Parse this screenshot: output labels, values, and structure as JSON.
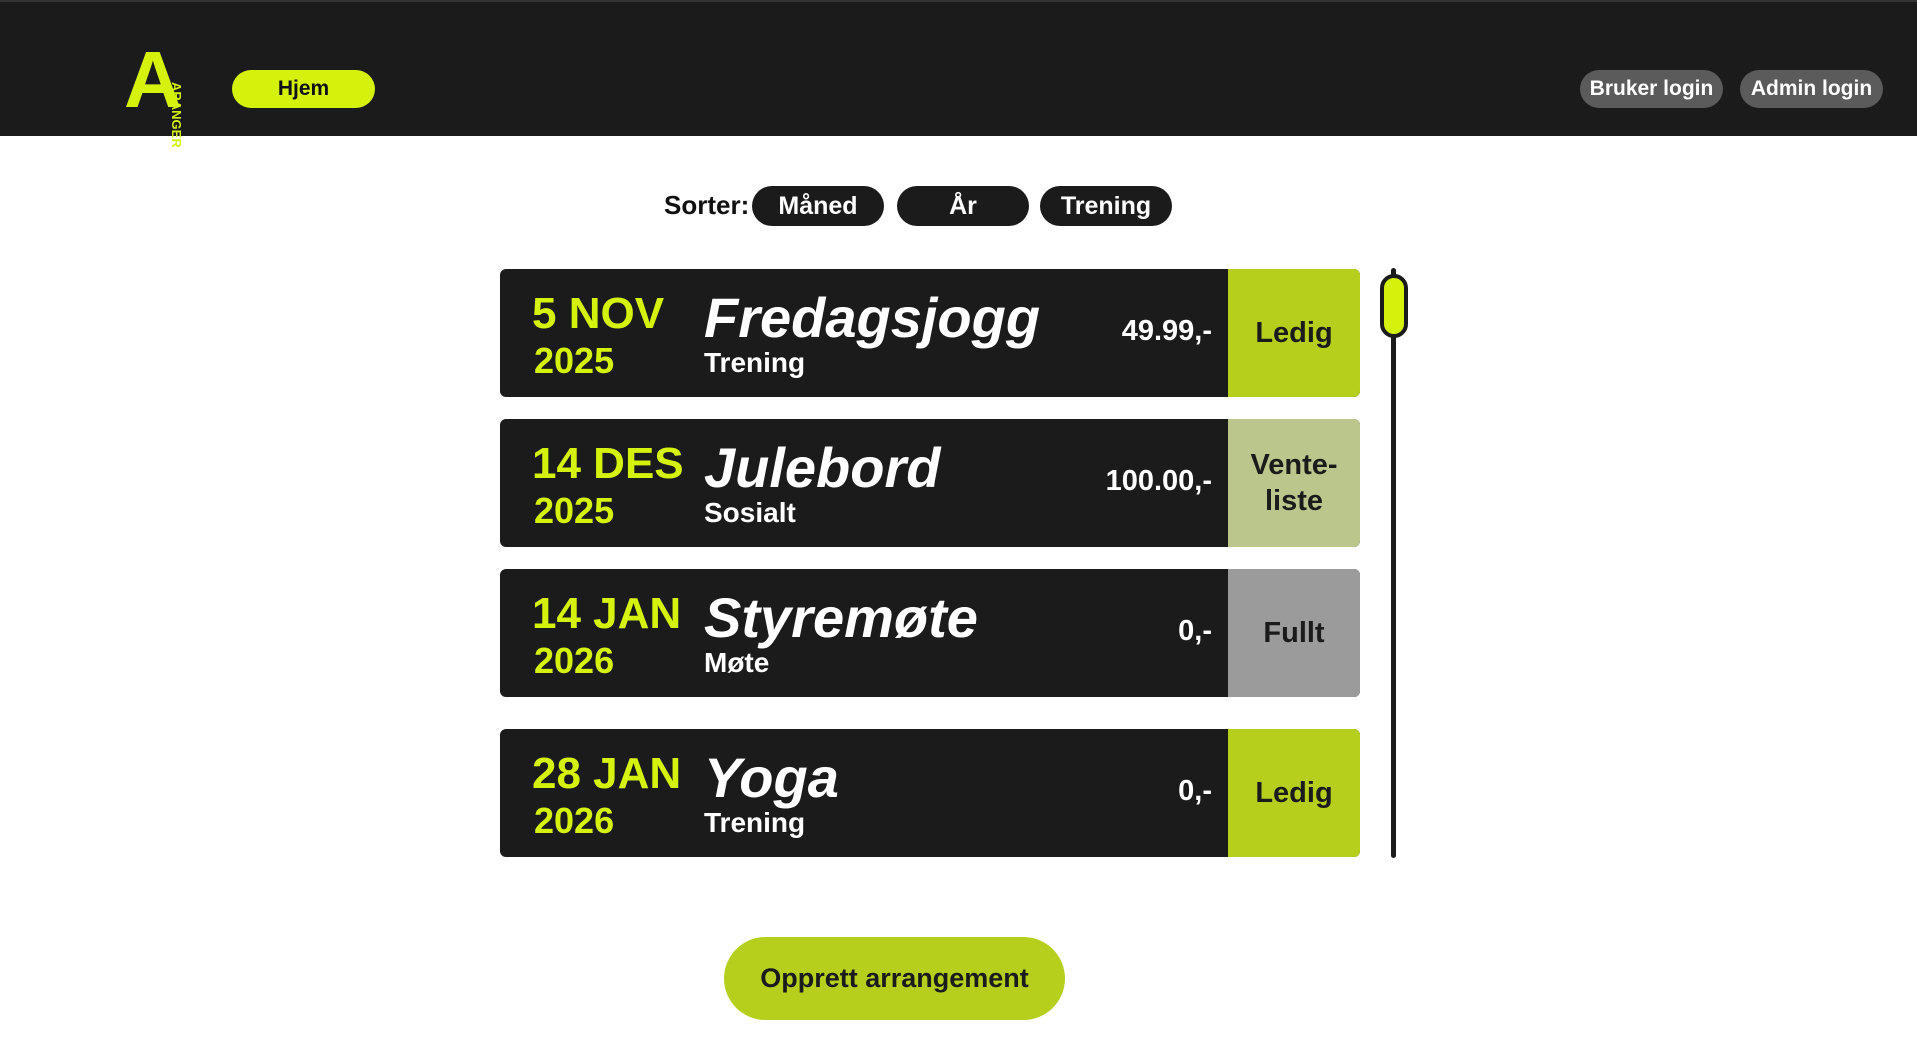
{
  "header": {
    "logo_letter": "A",
    "logo_text": "ARANGER",
    "home_label": "Hjem",
    "user_login_label": "Bruker login",
    "admin_login_label": "Admin login"
  },
  "sort": {
    "label": "Sorter:",
    "options": [
      "Måned",
      "År",
      "Trening"
    ]
  },
  "events": [
    {
      "day_month": "5 NOV",
      "year": "2025",
      "title": "Fredagsjogg",
      "category": "Trening",
      "price": "49.99,-",
      "status": "Ledig",
      "status_color": "#b6cf1c"
    },
    {
      "day_month": "14 DES",
      "year": "2025",
      "title": "Julebord",
      "category": "Sosialt",
      "price": "100.00,-",
      "status": "Vente-\nliste",
      "status_color": "#bbc68c"
    },
    {
      "day_month": "14 JAN",
      "year": "2026",
      "title": "Styremøte",
      "category": "Møte",
      "price": "0,-",
      "status": "Fullt",
      "status_color": "#9b9b9b"
    },
    {
      "day_month": "28 JAN",
      "year": "2026",
      "title": "Yoga",
      "category": "Trening",
      "price": "0,-",
      "status": "Ledig",
      "status_color": "#b6cf1c"
    }
  ],
  "create_button_label": "Opprett arrangement",
  "colors": {
    "accent": "#d5f20c",
    "dark": "#1b1b1b",
    "button_green": "#b6cf1c"
  }
}
